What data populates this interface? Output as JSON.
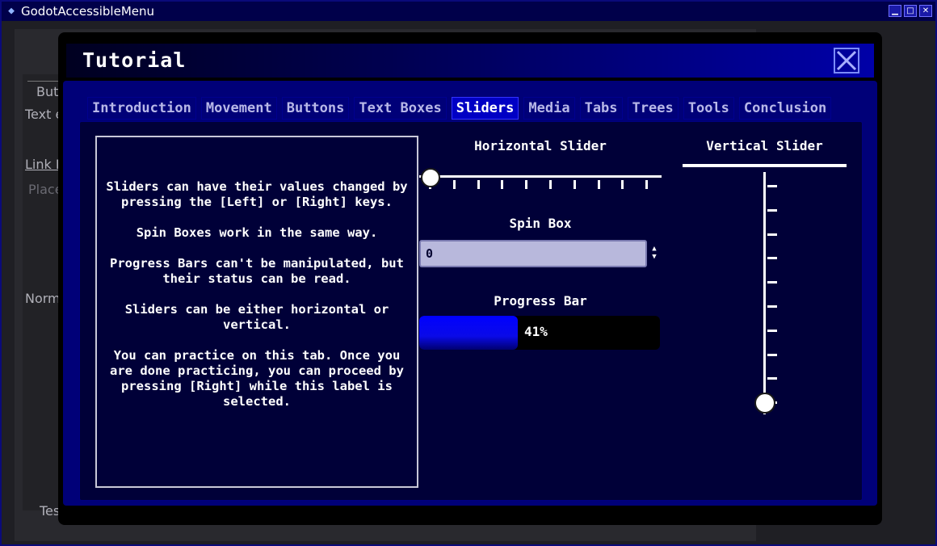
{
  "window": {
    "title": "GodotAccessibleMenu",
    "app_icon": "godot-icon",
    "controls": {
      "minimize": "▁",
      "maximize": "□",
      "close": "✕"
    }
  },
  "background": {
    "labels": [
      "But",
      "Text e",
      "Link B",
      "Place",
      "Norm",
      "Tes"
    ]
  },
  "dialog": {
    "title": "Tutorial",
    "close_icon": "close-icon",
    "tabs": [
      {
        "label": "Introduction",
        "active": false
      },
      {
        "label": "Movement",
        "active": false
      },
      {
        "label": "Buttons",
        "active": false
      },
      {
        "label": "Text Boxes",
        "active": false
      },
      {
        "label": "Sliders",
        "active": true
      },
      {
        "label": "Media",
        "active": false
      },
      {
        "label": "Tabs",
        "active": false
      },
      {
        "label": "Trees",
        "active": false
      },
      {
        "label": "Tools",
        "active": false
      },
      {
        "label": "Conclusion",
        "active": false
      }
    ],
    "info_paragraphs": [
      "Sliders can have their values changed by pressing the [Left] or [Right] keys.",
      "Spin Boxes work in the same way.",
      "Progress Bars can't be manipulated, but their status can be read.",
      "Sliders can be either horizontal or vertical.",
      "You can practice on this tab. Once you are done practicing, you can proceed by pressing [Right] while this label is selected."
    ],
    "horizontal_slider": {
      "title": "Horizontal Slider",
      "value_fraction": 0.0,
      "ticks": 10
    },
    "spin_box": {
      "title": "Spin Box",
      "value": "0"
    },
    "progress_bar": {
      "title": "Progress Bar",
      "value_percent": 41,
      "text": "41%"
    },
    "vertical_slider": {
      "title": "Vertical Slider",
      "value_fraction": 0.0,
      "ticks": 10
    }
  }
}
